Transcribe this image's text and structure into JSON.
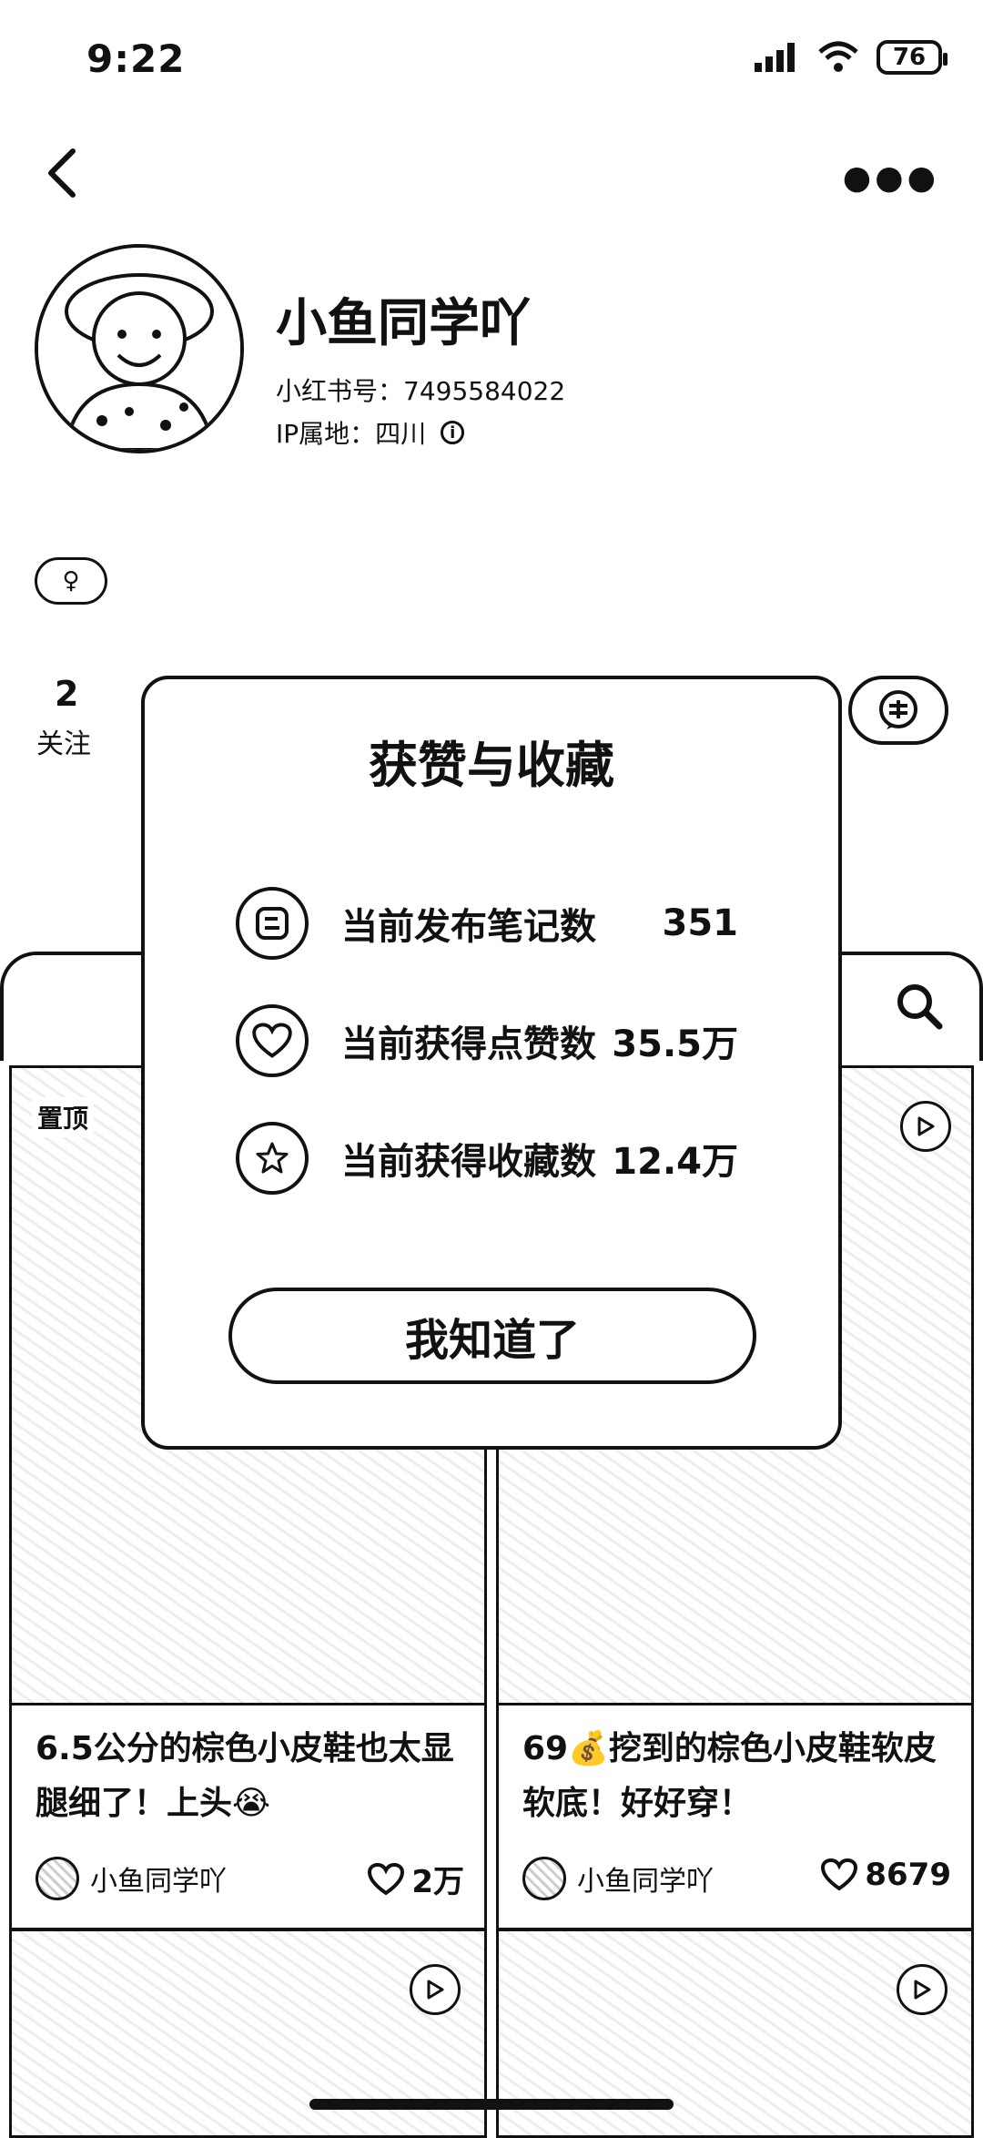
{
  "status_bar": {
    "time": "9:22",
    "battery": "76"
  },
  "profile": {
    "nickname": "小鱼同学吖",
    "red_id": "小红书号：7495584022",
    "ip": "IP属地：四川",
    "gender_icon": "♀",
    "following_count": "2",
    "following_label": "关注"
  },
  "modal": {
    "title": "获赞与收藏",
    "stats": [
      {
        "icon": "note-icon",
        "label": "当前发布笔记数",
        "value": "351"
      },
      {
        "icon": "heart-icon",
        "label": "当前获得点赞数",
        "value": "35.5万"
      },
      {
        "icon": "star-icon",
        "label": "当前获得收藏数",
        "value": "12.4万"
      }
    ],
    "ok_label": "我知道了"
  },
  "feed": {
    "pinned_label": "置顶",
    "cards": [
      {
        "title": "6.5公分的棕色小皮鞋也太显腿细了！上头😭",
        "author": "小鱼同学吖",
        "likes": "2万"
      },
      {
        "title": "69💰挖到的棕色小皮鞋软皮软底！好好穿！",
        "author": "小鱼同学吖",
        "likes": "8679"
      }
    ]
  }
}
